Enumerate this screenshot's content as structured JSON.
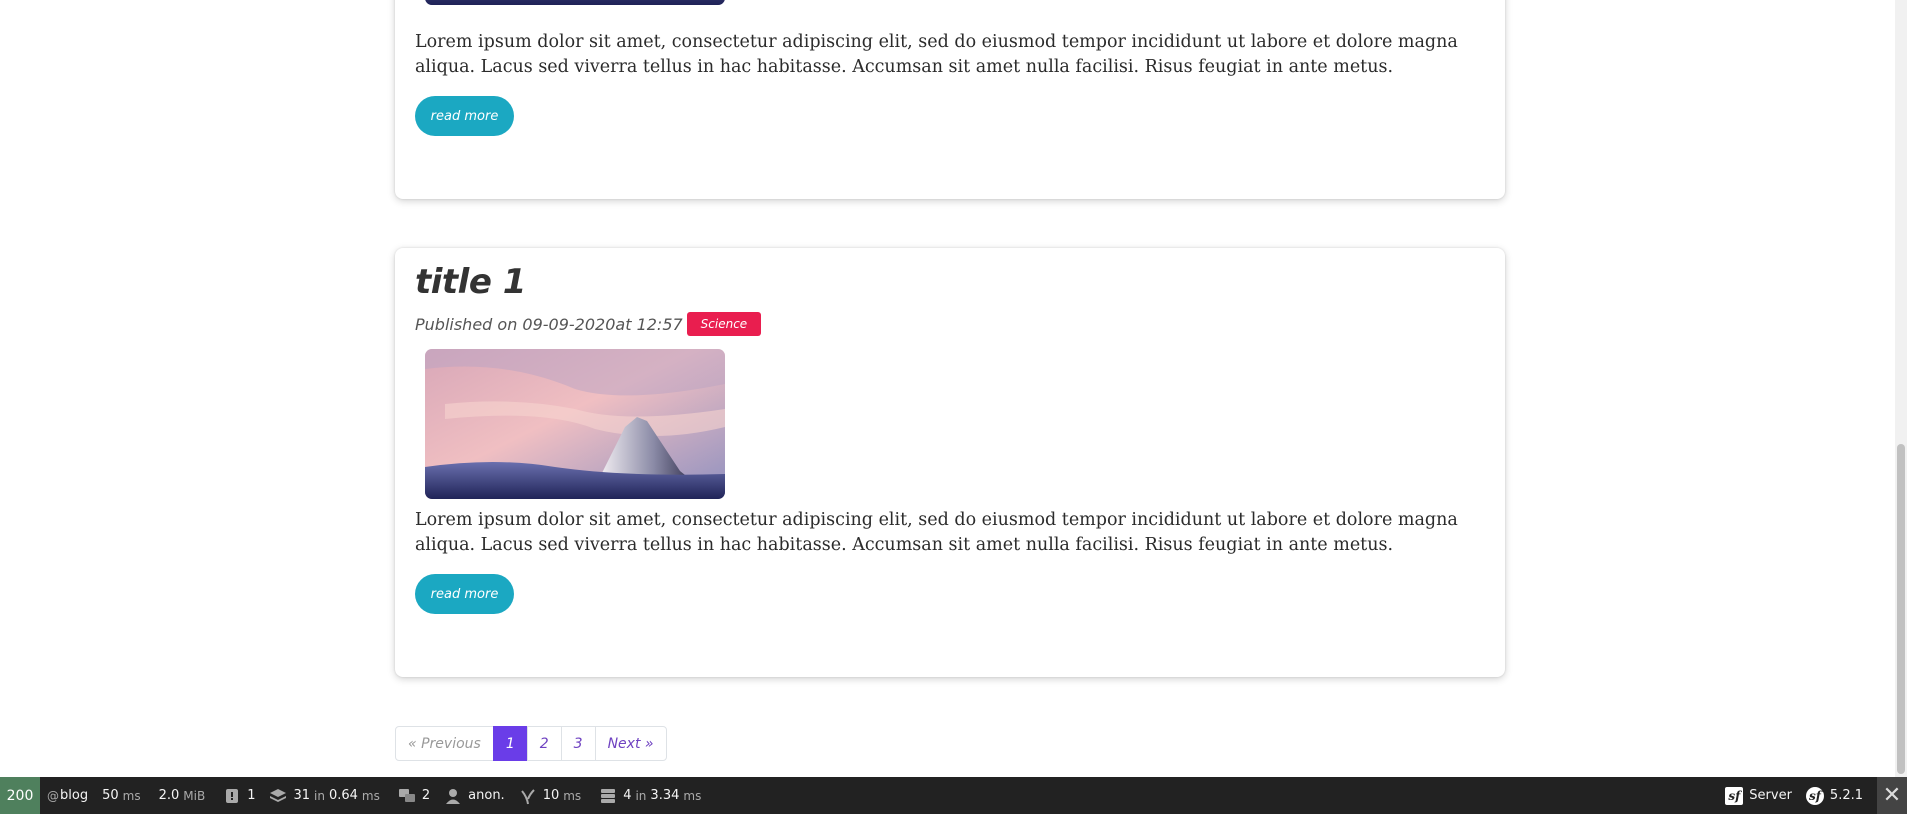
{
  "posts": [
    {
      "excerpt": "Lorem ipsum dolor sit amet, consectetur adipiscing elit, sed do eiusmod tempor incididunt ut labore et dolore magna aliqua. Lacus sed viverra tellus in hac habitasse. Accumsan sit amet nulla facilisi. Risus feugiat in ante metus.",
      "button_label": "read more"
    },
    {
      "title": "title 1",
      "published": "Published on 09-09-2020at 12:57",
      "category": "Science",
      "excerpt": "Lorem ipsum dolor sit amet, consectetur adipiscing elit, sed do eiusmod tempor incididunt ut labore et dolore magna aliqua. Lacus sed viverra tellus in hac habitasse. Accumsan sit amet nulla facilisi. Risus feugiat in ante metus.",
      "button_label": "read more"
    }
  ],
  "pagination": {
    "previous": "« Previous",
    "pages": [
      "1",
      "2",
      "3"
    ],
    "active_page": "1",
    "next": "Next »"
  },
  "debug_toolbar": {
    "status_code": "200",
    "route_prefix": "@",
    "route": "blog",
    "time_value": "50",
    "time_unit": "ms",
    "memory_value": "2.0",
    "memory_unit": "MiB",
    "logs_count": "1",
    "db_queries": "31",
    "db_in": "in",
    "db_time": "0.64",
    "db_unit": "ms",
    "translations_count": "2",
    "user": "anon.",
    "twig_time": "10",
    "twig_unit": "ms",
    "cache_calls": "4",
    "cache_in": "in",
    "cache_time": "3.34",
    "cache_unit": "ms",
    "server_label": "Server",
    "symfony_version": "5.2.1",
    "close_label": "✕",
    "status_color": "#4f805d"
  },
  "colors": {
    "badge": "#e91e4f",
    "button": "#1ba8c2",
    "active_page": "#6a3de8"
  }
}
